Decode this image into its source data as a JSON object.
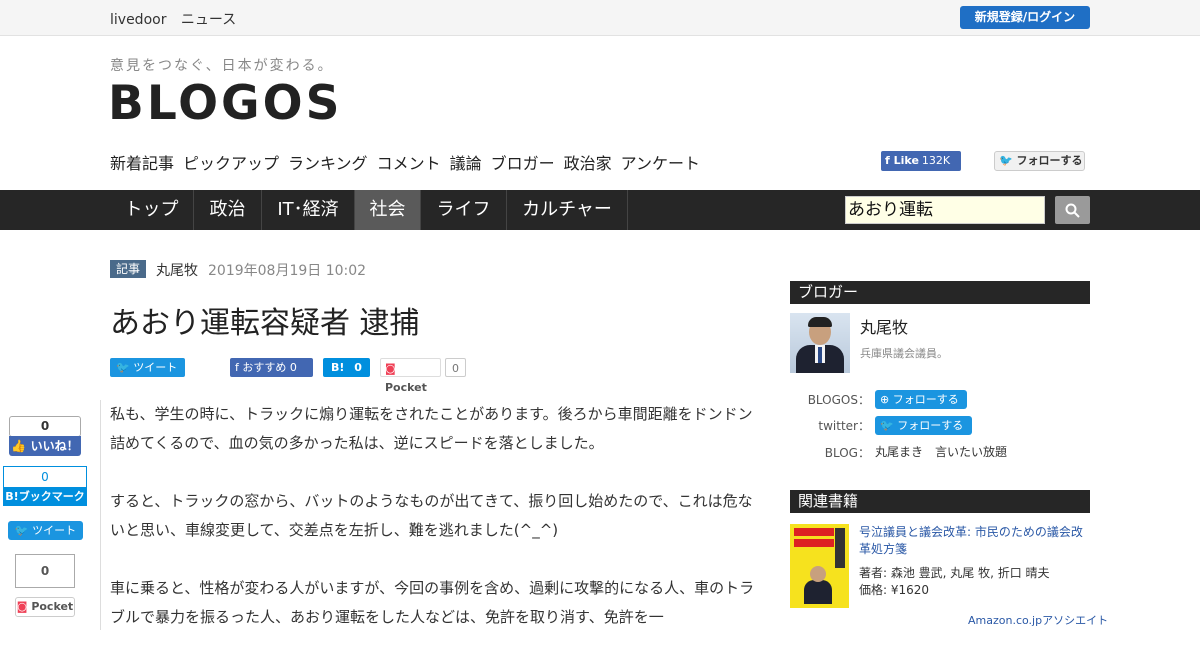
{
  "topbar": {
    "site_name": "livedoor",
    "section": "ニュース",
    "login_label": "新規登録/ログイン"
  },
  "header": {
    "tagline": "意見をつなぐ、日本が変わる。",
    "logo": "BLOGOS",
    "subnav": [
      "新着記事",
      "ピックアップ",
      "ランキング",
      "コメント",
      "議論",
      "ブロガー",
      "政治家",
      "アンケート"
    ],
    "fb_like_label": "Like",
    "fb_like_count": "132K",
    "tw_follow_label": "フォローする"
  },
  "mainnav": {
    "items": [
      "トップ",
      "政治",
      "IT･経済",
      "社会",
      "ライフ",
      "カルチャー"
    ],
    "active": "社会"
  },
  "search": {
    "value": "あおり運転"
  },
  "article": {
    "tag": "記事",
    "author": "丸尾牧",
    "date": "2019年08月19日 10:02",
    "title": "あおり運転容疑者 逮捕",
    "share": {
      "tweet": "ツイート",
      "fb": "おすすめ",
      "fb_count": "0",
      "hb": "B!",
      "hb_count": "0",
      "pocket": "Pocket",
      "pocket_count": "0"
    },
    "paragraphs": [
      "私も、学生の時に、トラックに煽り運転をされたことがあります。後ろから車間距離をドンドン詰めてくるので、血の気の多かった私は、逆にスピードを落としました。",
      "すると、トラックの窓から、バットのようなものが出てきて、振り回し始めたので、これは危ないと思い、車線変更して、交差点を左折し、難を逃れました(^_^)",
      "車に乗ると、性格が変わる人がいますが、今回の事例を含め、過剰に攻撃的になる人、車のトラブルで暴力を振るった人、あおり運転をした人などは、免許を取り消す、免許を一"
    ]
  },
  "float_share": {
    "fb_count": "0",
    "fb_label": "いいね！",
    "hb_count": "0",
    "hb_label": "B!ブックマーク",
    "tw_label": "ツイート",
    "pocket_count": "0",
    "pocket_label": "Pocket"
  },
  "sidebar": {
    "blogger_head": "ブロガー",
    "blogger_name": "丸尾牧",
    "blogger_desc": "兵庫県議会議員。",
    "blogos_label": "BLOGOS：",
    "blogos_follow": "フォローする",
    "twitter_label": "twitter：",
    "twitter_follow": "フォローする",
    "blog_label": "BLOG：",
    "blog_name": "丸尾まき　言いたい放題",
    "books_head": "関連書籍",
    "book_title": "号泣議員と議会改革: 市民のための議会改革処方箋",
    "book_author": "著者: 森池 豊武, 丸尾 牧, 折口 晴夫",
    "book_price": "価格: ¥1620",
    "amazon": "Amazon.co.jpアソシエイト"
  },
  "colors": {
    "nav_bg": "#262626",
    "active_tab": "#5a5a5a",
    "login_blue": "#1f6fc5",
    "twitter": "#1b95e0",
    "facebook": "#4267b2",
    "hatena": "#008fde"
  }
}
